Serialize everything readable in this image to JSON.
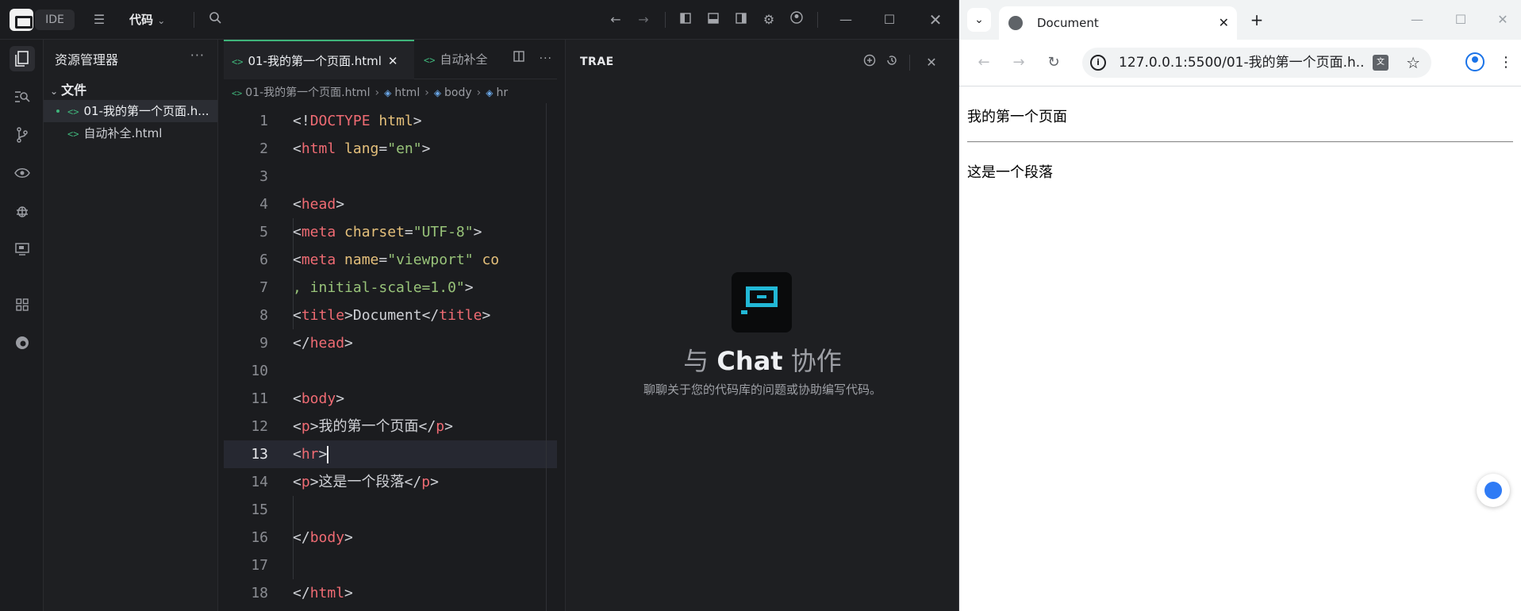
{
  "titlebar": {
    "ide_badge": "IDE",
    "menu_label": "代码",
    "chevron": "⌄"
  },
  "explorer": {
    "title": "资源管理器",
    "more": "···",
    "folder": "文件",
    "folder_chevron": "⌄",
    "files": [
      {
        "name": "01-我的第一个页面.h...",
        "icon": "<>"
      },
      {
        "name": "自动补全.html",
        "icon": "<>"
      }
    ]
  },
  "editor": {
    "tabs": [
      {
        "icon": "<>",
        "label": "01-我的第一个页面.html",
        "close": "✕"
      },
      {
        "icon": "<>",
        "label": "自动补全"
      }
    ],
    "breadcrumb": [
      "01-我的第一个页面.html",
      "html",
      "body",
      "hr"
    ],
    "line_numbers": [
      "1",
      "2",
      "3",
      "4",
      "5",
      "6",
      "7",
      "8",
      "9",
      "10",
      "11",
      "12",
      "13",
      "14",
      "15",
      "16",
      "17",
      "18"
    ],
    "current_line": "13"
  },
  "chat": {
    "title": "TRAE",
    "heading_prefix": "与",
    "heading_bold": "Chat",
    "heading_suffix": "协作",
    "subtitle": "聊聊关于您的代码库的问题或协助编写代码。"
  },
  "browser": {
    "tab_title": "Document",
    "tab_close": "✕",
    "new_tab": "+",
    "url": "127.0.0.1:5500/01-我的第一个页面.h...",
    "page": {
      "paragraph1": "我的第一个页面",
      "paragraph2": "这是一个段落"
    }
  },
  "icons": {
    "menu": "hamburger-icon",
    "search": "search-icon",
    "back": "arrow-left-icon",
    "forward": "arrow-right-icon",
    "reload": "reload-icon",
    "star": "star-icon",
    "profile": "profile-icon"
  },
  "colors": {
    "accent_green": "#3fb47a",
    "tag": "#ef6b73",
    "attr": "#e5c07b",
    "string": "#98c379",
    "chat_logo": "#22b8d6",
    "link_blue": "#1a73e8"
  }
}
